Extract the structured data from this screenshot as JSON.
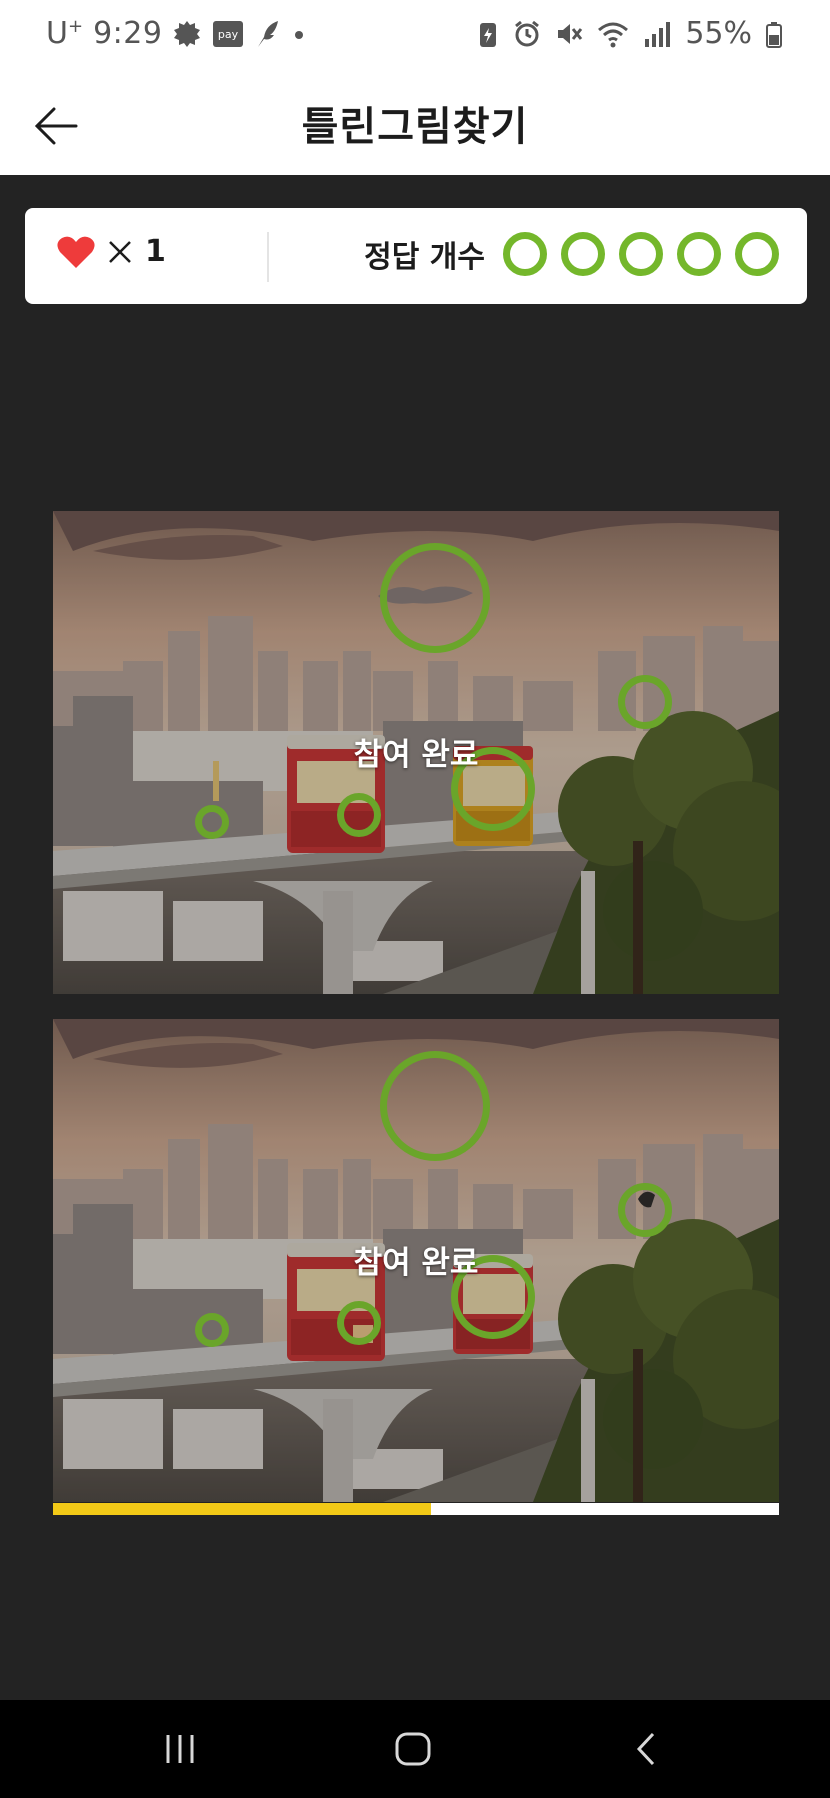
{
  "status_bar": {
    "carrier": "U",
    "carrier_sup": "+",
    "time": "9:29",
    "pay_label": "pay",
    "battery_percent": "55%",
    "left_icons": [
      "gear-badge-icon",
      "pay-icon",
      "feather-icon",
      "dot-icon"
    ],
    "right_icons": [
      "battery-saver-icon",
      "alarm-icon",
      "mute-icon",
      "wifi-icon",
      "signal-icon",
      "battery-icon"
    ]
  },
  "header": {
    "title": "틀린그림찾기",
    "back_icon": "arrow-left-icon"
  },
  "info": {
    "lives_icon": "heart-icon",
    "times_symbol": "×",
    "lives_count": "1",
    "answers_label": "정답 개수",
    "answers_total": 5,
    "answers_found": 5,
    "answer_color": "#74b72b"
  },
  "game": {
    "overlay_text": "참여 완료",
    "top_image": "busan-sky-capsule-train-original",
    "bottom_image": "busan-sky-capsule-train-modified",
    "mark_color": "#6aa52a",
    "differences": [
      "cloud",
      "bird-on-building",
      "yellow-tram",
      "tram-window",
      "pole-sign"
    ]
  },
  "progress": {
    "fraction": 0.52,
    "fill_color": "#f2c917"
  },
  "nav": {
    "recent_icon": "recent-apps-icon",
    "home_icon": "home-icon",
    "back_icon": "back-chevron-icon"
  }
}
